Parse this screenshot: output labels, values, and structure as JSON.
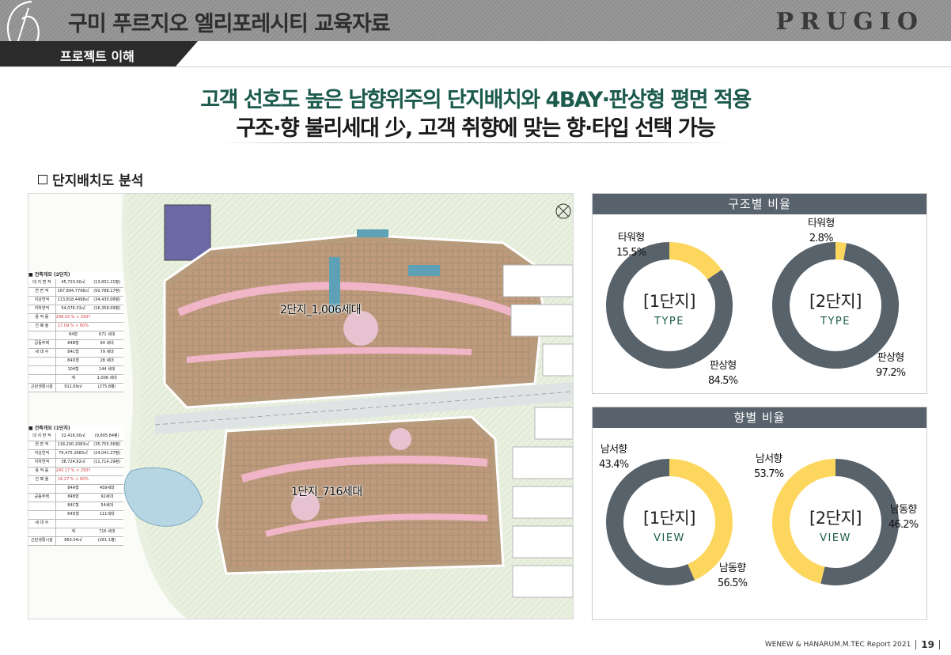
{
  "header": {
    "doc_title": "구미 푸르지오 엘리포레시티 교육자료",
    "brand": "PRUGIO",
    "section": "프로젝트 이해"
  },
  "headline": {
    "line1": "고객 선호도 높은 남향위주의 단지배치와 4BAY·판상형 평면 적용",
    "line2": "구조·향 불리세대 少, 고객 취향에 맞는 향·타입 선택 가능"
  },
  "subhead": "단지배치도 분석",
  "map": {
    "complex2_label": "2단지_1,006세대",
    "complex1_label": "1단지_716세대",
    "table2": {
      "title": "■ 건축개요 (2단지)",
      "rows": [
        {
          "k": "대 지 면 적",
          "v1": "45,723.00㎡",
          "v2": "(13,831.21평)"
        },
        {
          "k": "연 면 적",
          "v1": "167,894.7798㎡",
          "v2": "(50,788.17평)"
        },
        {
          "k": "지상연적",
          "v1": "113,818.4498㎡",
          "v2": "(34,430.08평)"
        },
        {
          "k": "지하연적",
          "v1": "54,076.33㎡",
          "v2": "(16,358.09평)"
        },
        {
          "k": "용 적 률",
          "v1": "248.93 % < 250%",
          "v2": ""
        },
        {
          "k": "건 폐 율",
          "v1": "17.09 % < 60%",
          "v2": ""
        },
        {
          "k": "",
          "v1": "84형",
          "v2": "671 세대"
        },
        {
          "k": "공동주택",
          "v1": "84B형",
          "v2": "84 세대"
        },
        {
          "k": "세 대 수",
          "v1": "84C형",
          "v2": "79 세대"
        },
        {
          "k": "",
          "v1": "84D형",
          "v2": "28 세대"
        },
        {
          "k": "",
          "v1": "104형",
          "v2": "144 세대"
        },
        {
          "k": "",
          "v1": "계",
          "v2": "1,006 세대"
        },
        {
          "k": "근린생활시설",
          "v1": "911.69㎡",
          "v2": "(275.8평)"
        }
      ]
    },
    "table1": {
      "title": "■ 건축개요 (1단지)",
      "rows": [
        {
          "k": "대 지 면 적",
          "v1": "32,416.00㎡",
          "v2": "(9,805.84평)"
        },
        {
          "k": "연 면 적",
          "v1": "118,200.2083㎡",
          "v2": "(35,755.56평)"
        },
        {
          "k": "지상연적",
          "v1": "79,475.2883㎡",
          "v2": "(24,041.27평)"
        },
        {
          "k": "지하연적",
          "v1": "38,724.92㎡",
          "v2": "(11,714.29평)"
        },
        {
          "k": "용 적 률",
          "v1": "245.17 % < 250%",
          "v2": ""
        },
        {
          "k": "건 폐 율",
          "v1": "16.27 % < 60%",
          "v2": ""
        },
        {
          "k": "",
          "v1": "84A형",
          "v2": "459세대"
        },
        {
          "k": "공동주택",
          "v1": "84B형",
          "v2": "92세대"
        },
        {
          "k": "",
          "v1": "84C형",
          "v2": "54세대"
        },
        {
          "k": "",
          "v1": "84D형",
          "v2": "111세대"
        },
        {
          "k": "세 대 수",
          "v1": "",
          "v2": ""
        },
        {
          "k": "",
          "v1": "계",
          "v2": "716 세대"
        },
        {
          "k": "근린생활시설",
          "v1": "863.04㎡",
          "v2": "(261.1평)"
        }
      ]
    }
  },
  "panels": {
    "structure": {
      "title": "구조별 비율",
      "charts": [
        {
          "center_big": "[1단지]",
          "center_small": "TYPE",
          "segments": [
            {
              "name": "타워형",
              "value": 15.5,
              "value_label": "15.5%",
              "color": "#fdd65e"
            },
            {
              "name": "판상형",
              "value": 84.5,
              "value_label": "84.5%",
              "color": "#58626b"
            }
          ]
        },
        {
          "center_big": "[2단지]",
          "center_small": "TYPE",
          "segments": [
            {
              "name": "타워형",
              "value": 2.8,
              "value_label": "2.8%",
              "color": "#fdd65e"
            },
            {
              "name": "판상형",
              "value": 97.2,
              "value_label": "97.2%",
              "color": "#58626b"
            }
          ]
        }
      ]
    },
    "orientation": {
      "title": "향별 비율",
      "charts": [
        {
          "center_big": "[1단지]",
          "center_small": "VIEW",
          "segments": [
            {
              "name": "남서향",
              "value": 43.4,
              "value_label": "43.4%",
              "color": "#fdd65e"
            },
            {
              "name": "남동향",
              "value": 56.5,
              "value_label": "56.5%",
              "color": "#58626b"
            }
          ]
        },
        {
          "center_big": "[2단지]",
          "center_small": "VIEW",
          "segments": [
            {
              "name": "남서향",
              "value": 53.7,
              "value_label": "53.7%",
              "color": "#58626b"
            },
            {
              "name": "남동향",
              "value": 46.2,
              "value_label": "46.2%",
              "color": "#fdd65e"
            }
          ]
        }
      ]
    }
  },
  "footer": {
    "report": "WENEW & HANARUM.M.TEC Report 2021",
    "page": "19"
  }
}
